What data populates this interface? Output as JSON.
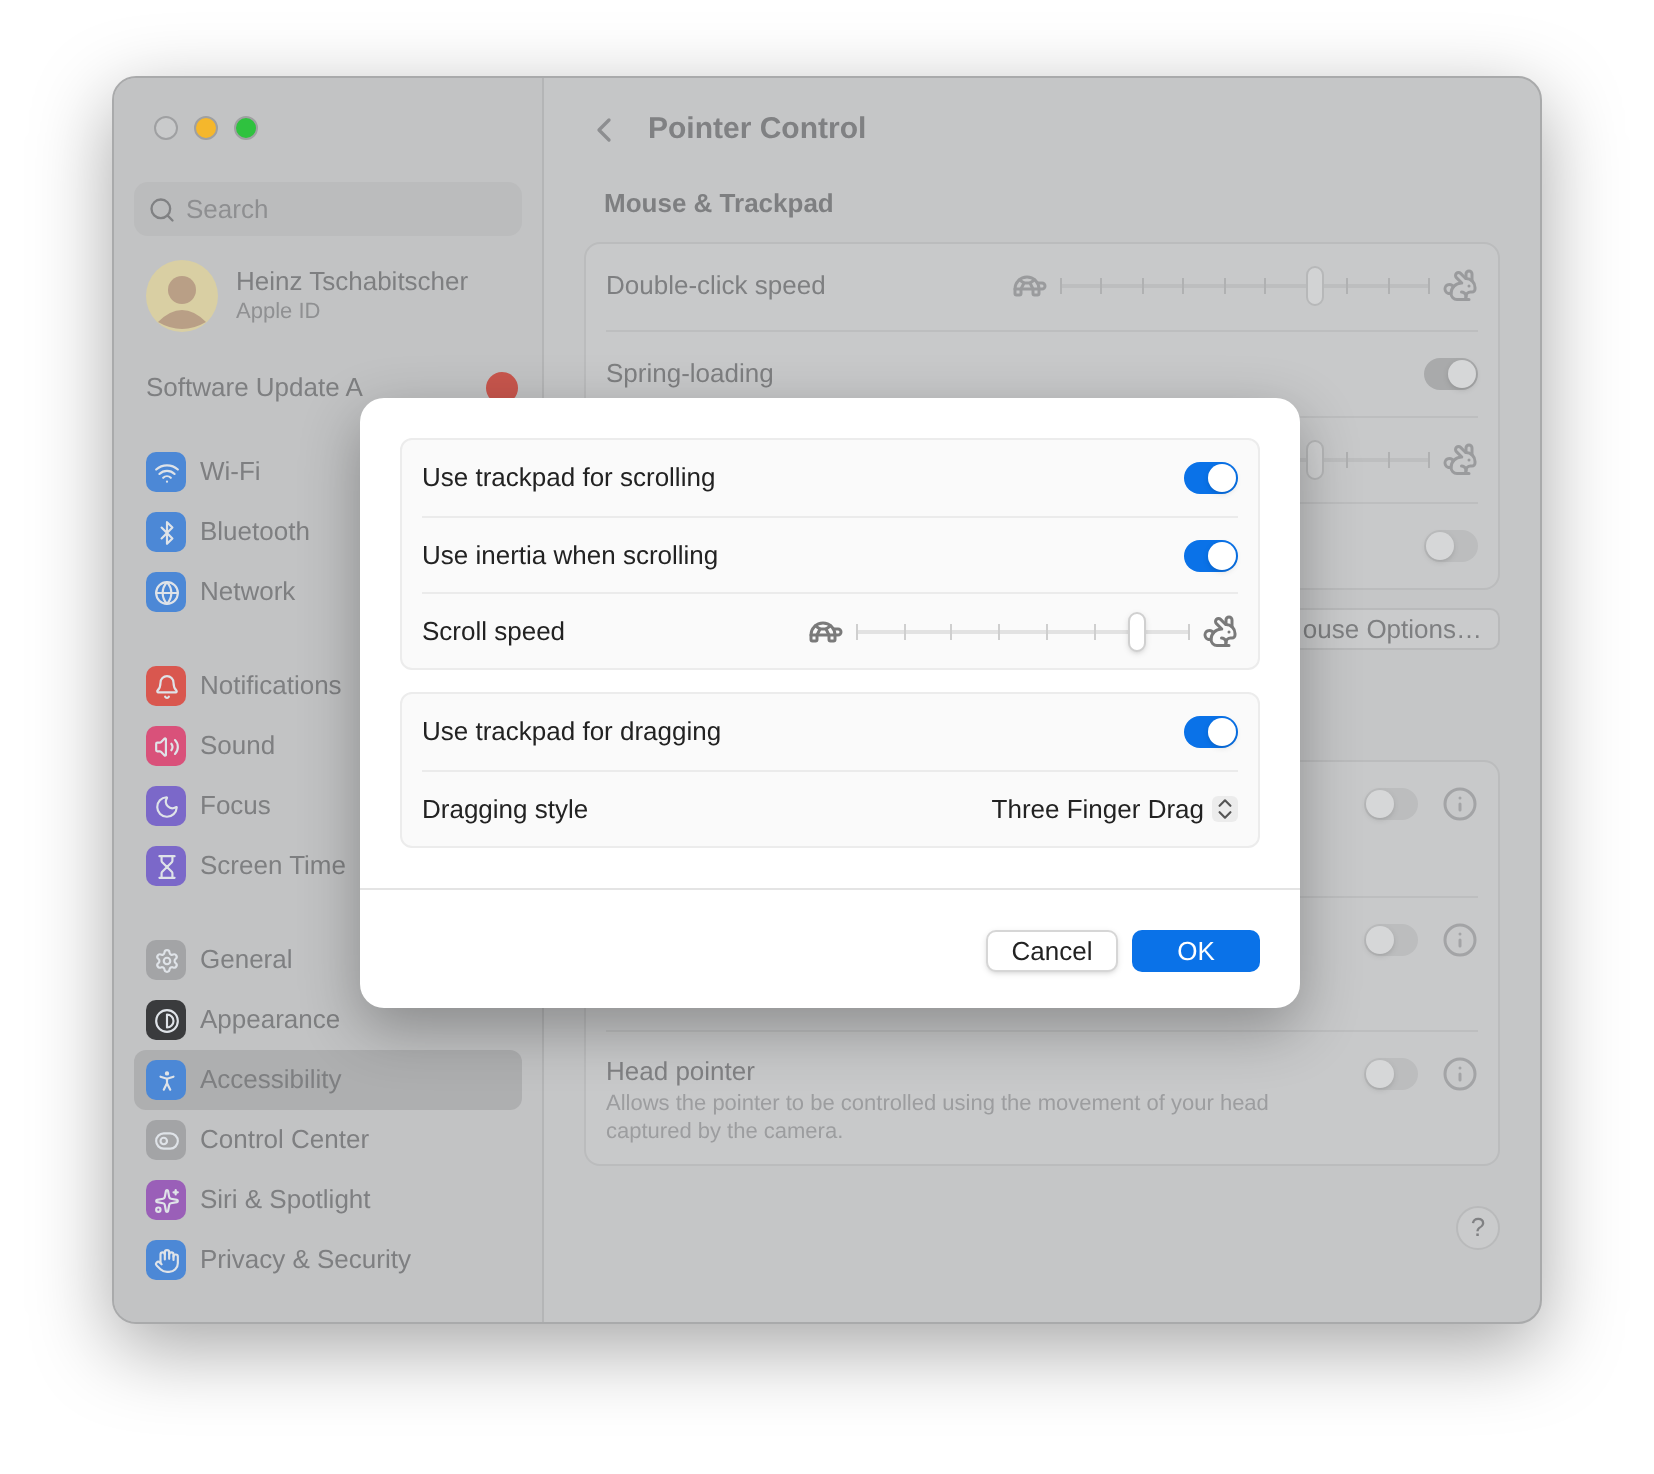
{
  "window": {
    "traffic_lights": [
      {
        "color": "#c9cacb"
      },
      {
        "color": "#f5b72c"
      },
      {
        "color": "#2fc23f"
      }
    ]
  },
  "sidebar": {
    "search": {
      "placeholder": "Search"
    },
    "profile": {
      "name": "Heinz Tschabitscher",
      "subtitle": "Apple ID"
    },
    "update_notice": "Software Update A",
    "sections": [
      {
        "items": [
          {
            "label": "Wi-Fi",
            "color": "#4c88d6",
            "selected": false
          },
          {
            "label": "Bluetooth",
            "color": "#4c88d6",
            "selected": false
          },
          {
            "label": "Network",
            "color": "#4c88d6",
            "selected": false
          }
        ]
      },
      {
        "items": [
          {
            "label": "Notifications",
            "color": "#d9574f",
            "selected": false
          },
          {
            "label": "Sound",
            "color": "#d9517a",
            "selected": false
          },
          {
            "label": "Focus",
            "color": "#7b68c9",
            "selected": false
          },
          {
            "label": "Screen Time",
            "color": "#7b68c9",
            "selected": false
          }
        ]
      },
      {
        "items": [
          {
            "label": "General",
            "color": "#a3a4a6",
            "selected": false
          },
          {
            "label": "Appearance",
            "color": "#3a3b3d",
            "selected": false
          },
          {
            "label": "Accessibility",
            "color": "#4c88d6",
            "selected": true
          },
          {
            "label": "Control Center",
            "color": "#a3a4a6",
            "selected": false
          },
          {
            "label": "Siri & Spotlight",
            "color": "#9a5fb8",
            "selected": false
          },
          {
            "label": "Privacy & Security",
            "color": "#4c88d6",
            "selected": false
          }
        ]
      }
    ]
  },
  "main": {
    "title": "Pointer Control",
    "section_title": "Mouse & Trackpad",
    "group_1": [
      {
        "kind": "slider",
        "label": "Double-click speed",
        "level": 0.7
      },
      {
        "kind": "toggle",
        "label": "Spring-loading",
        "on": true
      },
      {
        "kind": "slider",
        "level": 0.7
      },
      {
        "kind": "toggle",
        "on": false
      }
    ],
    "options_button": "ouse Options…",
    "group_2": [
      {
        "kind": "toggle",
        "on": false
      },
      {
        "kind": "toggle",
        "on": false
      },
      {
        "kind": "toggle",
        "label": "Head pointer",
        "description": "Allows the pointer to be controlled using the movement of your head captured by the camera.",
        "on": false
      }
    ],
    "help": "?"
  },
  "dialog": {
    "groups": [
      [
        {
          "kind": "toggle",
          "label": "Use trackpad for scrolling",
          "on": true
        },
        {
          "kind": "toggle",
          "label": "Use inertia when scrolling",
          "on": true
        },
        {
          "kind": "slider",
          "label": "Scroll speed",
          "level": 0.86
        }
      ],
      [
        {
          "kind": "toggle",
          "label": "Use trackpad for dragging",
          "on": true
        },
        {
          "kind": "popup",
          "label": "Dragging style",
          "value": "Three Finger Drag"
        }
      ]
    ],
    "buttons": [
      {
        "label": "Cancel",
        "kind": "secondary"
      },
      {
        "label": "OK",
        "kind": "primary"
      }
    ]
  }
}
